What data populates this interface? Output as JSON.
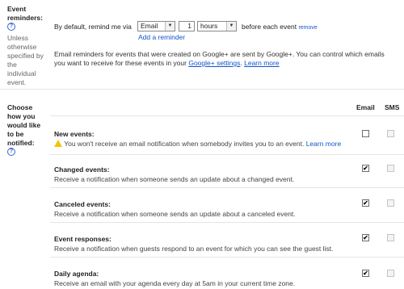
{
  "event_reminders": {
    "label_line1": "Event",
    "label_line2": "reminders:",
    "note_lines": [
      "Unless",
      "otherwise",
      "specified by",
      "the",
      "individual",
      "event."
    ],
    "prefix_text": "By default, remind me via",
    "method_value": "Email",
    "amount_value": "1",
    "unit_value": "hours",
    "suffix_text": "before each event",
    "remove_link": "remove",
    "add_reminder_link": "Add a reminder",
    "google_plus_text_line1": "Email reminders for events that were created on Google+ are sent by Google+. You can control which emails",
    "google_plus_text_line2_pre": "you want to receive for these events in your",
    "google_plus_settings_link": "Google+ settings",
    "learn_more_link": "Learn more"
  },
  "notifications": {
    "label_lines": [
      "Choose",
      "how you",
      "would like",
      "to be",
      "notified:"
    ],
    "col_email": "Email",
    "col_sms": "SMS",
    "rows": [
      {
        "title": "New events:",
        "desc": "You won't receive an email notification when somebody invites you to an event.",
        "link": "Learn more",
        "email": false,
        "sms": false,
        "warning": true
      },
      {
        "title": "Changed events:",
        "desc": "Receive a notification when someone sends an update about a changed event.",
        "email": true,
        "sms": false
      },
      {
        "title": "Canceled events:",
        "desc": "Receive a notification when someone sends an update about a canceled event.",
        "email": true,
        "sms": false
      },
      {
        "title": "Event responses:",
        "desc": "Receive a notification when guests respond to an event for which you can see the guest list.",
        "email": true,
        "sms": false
      },
      {
        "title": "Daily agenda:",
        "desc": "Receive an email with your agenda every day at 5am in your current time zone.",
        "email": true,
        "sms": false
      }
    ]
  },
  "icons": {
    "help": "help-icon",
    "warning": "warning-icon",
    "dropdown": "chevron-down-icon",
    "checkmark": "✔"
  }
}
